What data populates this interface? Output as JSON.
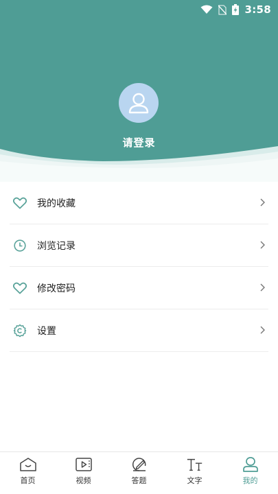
{
  "status_bar": {
    "time": "3:58"
  },
  "profile": {
    "login_text": "请登录"
  },
  "menu": {
    "items": [
      {
        "label": "我的收藏",
        "icon": "heart-icon"
      },
      {
        "label": "浏览记录",
        "icon": "clock-icon"
      },
      {
        "label": "修改密码",
        "icon": "heart-icon"
      },
      {
        "label": "设置",
        "icon": "gear-icon"
      }
    ]
  },
  "bottom_nav": {
    "items": [
      {
        "label": "首页",
        "icon": "home-icon"
      },
      {
        "label": "视频",
        "icon": "video-icon"
      },
      {
        "label": "答题",
        "icon": "pen-icon"
      },
      {
        "label": "文字",
        "icon": "text-icon"
      },
      {
        "label": "我的",
        "icon": "user-icon"
      }
    ],
    "active_index": 4
  },
  "colors": {
    "primary": "#4f9d95",
    "avatar_bg": "#b9d5f0",
    "wave_tint": "#eef6f5"
  }
}
